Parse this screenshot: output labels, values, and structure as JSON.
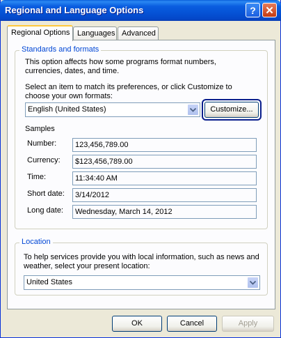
{
  "window": {
    "title": "Regional and Language Options",
    "help_glyph": "?",
    "close_glyph": "✕"
  },
  "tabs": [
    {
      "label": "Regional Options"
    },
    {
      "label": "Languages"
    },
    {
      "label": "Advanced"
    }
  ],
  "standards": {
    "legend": "Standards and formats",
    "description": "This option affects how some programs format numbers, currencies, dates, and time.",
    "instruction": "Select an item to match its preferences, or click Customize to choose your own formats:",
    "selected_locale": "English (United States)",
    "customize_label": "Customize...",
    "samples_heading": "Samples",
    "samples": [
      {
        "label": "Number:",
        "value": "123,456,789.00"
      },
      {
        "label": "Currency:",
        "value": "$123,456,789.00"
      },
      {
        "label": "Time:",
        "value": "11:34:40 AM"
      },
      {
        "label": "Short date:",
        "value": "3/14/2012"
      },
      {
        "label": "Long date:",
        "value": "Wednesday, March 14, 2012"
      }
    ]
  },
  "location": {
    "legend": "Location",
    "description": "To help services provide you with local information, such as news and weather, select your present location:",
    "selected": "United States"
  },
  "footer": {
    "ok_label": "OK",
    "cancel_label": "Cancel",
    "apply_label": "Apply"
  },
  "colors": {
    "titlebar": "#0553D6",
    "dialog_bg": "#ECE9D8",
    "group_legend": "#0046D5",
    "focus_ring": "#0A1E8C"
  },
  "icons": {
    "combo_arrow": "chevron-down-icon"
  }
}
